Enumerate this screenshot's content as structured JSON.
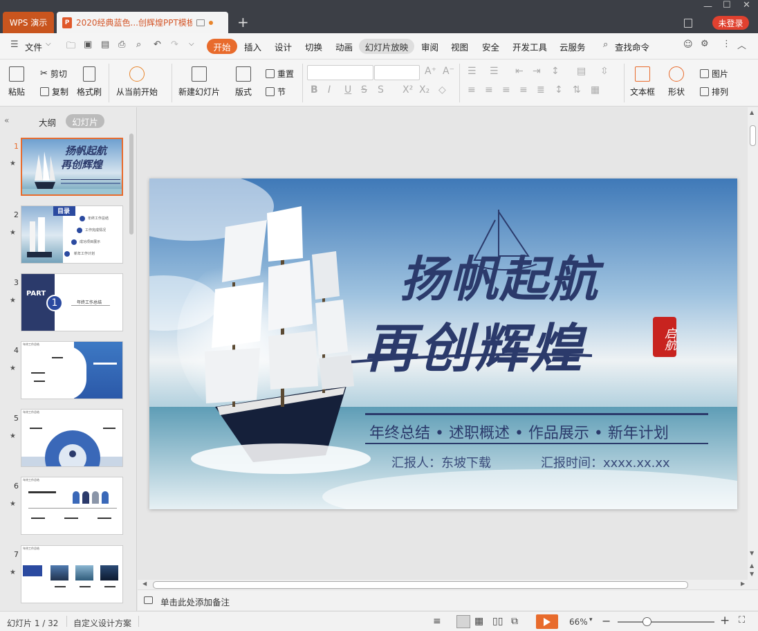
{
  "titlebar": {
    "app_tab": "WPS 演示",
    "doc_tab": "2020经典蓝色...创辉煌PPT模板",
    "new_tab": "+",
    "login": "未登录"
  },
  "menu": {
    "file": "文件",
    "items": [
      "开始",
      "插入",
      "设计",
      "切换",
      "动画",
      "幻灯片放映",
      "审阅",
      "视图",
      "安全",
      "开发工具",
      "云服务"
    ],
    "search": "查找命令"
  },
  "ribbon": {
    "paste": "粘贴",
    "cut": "剪切",
    "copy": "复制",
    "format_painter": "格式刷",
    "from_current": "从当前开始",
    "new_slide": "新建幻灯片",
    "layout": "版式",
    "reset": "重置",
    "section": "节",
    "textbox": "文本框",
    "shape": "形状",
    "picture": "图片",
    "arrange": "排列"
  },
  "leftpanel": {
    "tab_outline": "大纲",
    "tab_slides": "幻灯片",
    "thumbs": [
      {
        "num": "1",
        "title": "扬帆起航 再创辉煌"
      },
      {
        "num": "2",
        "title": "目录",
        "items": [
          "年终工作总结",
          "工作完成情况",
          "成功项目展示",
          "新年工作计划"
        ]
      },
      {
        "num": "3",
        "title": "PART",
        "sub": "年终工作总结",
        "digit": "1"
      },
      {
        "num": "4",
        "title": "年终工作总结"
      },
      {
        "num": "5",
        "title": "年终工作总结"
      },
      {
        "num": "6",
        "title": "年终工作总结"
      },
      {
        "num": "7",
        "title": "年终工作总结"
      }
    ]
  },
  "slide": {
    "title_line1": "扬帆起航",
    "title_line2": "再创辉煌",
    "seal": "启航",
    "subtitle": "年终总结 • 述职概述 • 作品展示 • 新年计划",
    "reporter": "汇报人：东坡下载",
    "report_time": "汇报时间：xxxx.xx.xx"
  },
  "notes": {
    "placeholder": "单击此处添加备注"
  },
  "status": {
    "slide_count": "幻灯片 1 / 32",
    "theme": "自定义设计方案",
    "zoom": "66%"
  },
  "colors": {
    "accent": "#e86b2c",
    "title_bar": "#3c3f46",
    "slide_navy": "#2b3a6b"
  }
}
